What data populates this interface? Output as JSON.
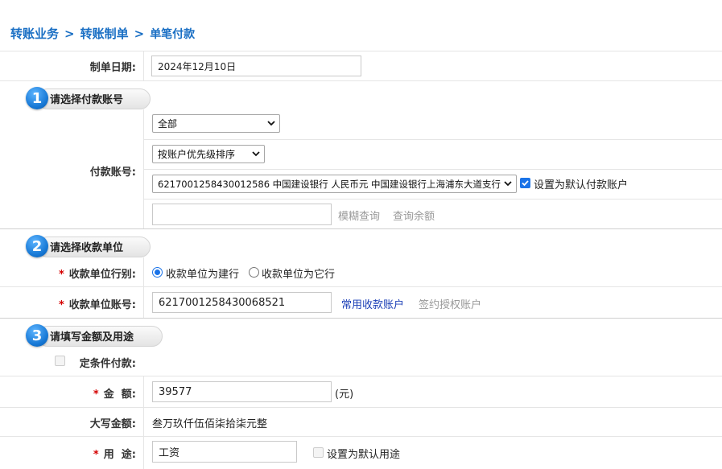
{
  "breadcrumb": {
    "item1": "转账业务",
    "sep": ">",
    "item2": "转账制单",
    "item3": "单笔付款"
  },
  "date_row": {
    "label": "制单日期:",
    "value": "2024年12月10日"
  },
  "step1": {
    "number": "1",
    "title": "请选择付款账号"
  },
  "payer": {
    "label": "付款账号:",
    "filter_select": "全部",
    "sort_select": "按账户优先级排序",
    "account_select": "6217001258430012586 中国建设银行 人民币元 中国建设银行上海浦东大道支行",
    "default_checkbox_label": "设置为默认付款账户",
    "default_checked": true,
    "search_placeholder": "",
    "fuzzy_query": "模糊查询",
    "balance_query": "查询余额"
  },
  "step2": {
    "number": "2",
    "title": "请选择收款单位"
  },
  "payee": {
    "required_mark": "*",
    "bank_type_label": "收款单位行别:",
    "radio_ccb": "收款单位为建行",
    "radio_other": "收款单位为它行",
    "selected": "收款单位为建行",
    "account_label": "收款单位账号:",
    "account_value": "6217001258430068521",
    "common_accounts": "常用收款账户",
    "signed_accounts": "签约授权账户"
  },
  "step3": {
    "number": "3",
    "title": "请填写金额及用途"
  },
  "amount": {
    "conditional_label": "定条件付款:",
    "required_mark": "*",
    "amount_label": "金  额:",
    "amount_value": "39577",
    "unit": "(元)",
    "uppercase_label": "大写金额:",
    "uppercase_value": "叁万玖仟伍佰柒拾柒元整",
    "purpose_label": "用  途:",
    "purpose_value": "工资",
    "default_purpose_label": "设置为默认用途"
  },
  "colors": {
    "accent": "#1a6fc4",
    "link": "#1a3eb6",
    "required": "#d40000",
    "step_badge": "#1677d4"
  }
}
